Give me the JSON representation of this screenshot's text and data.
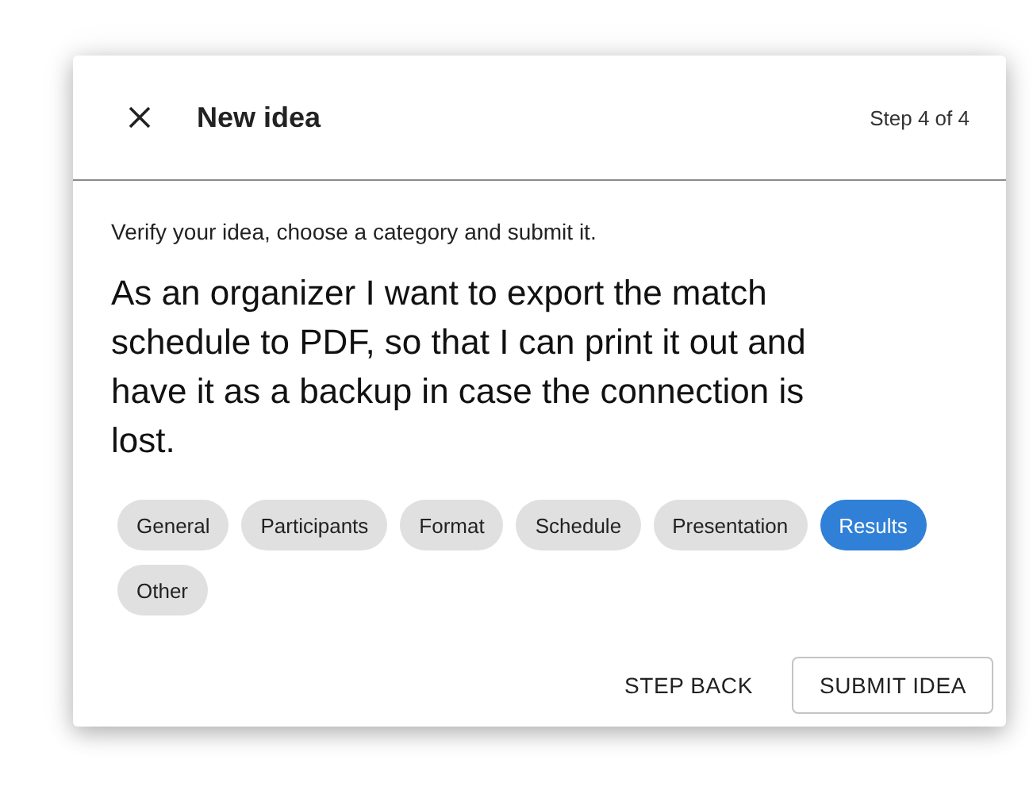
{
  "dialog": {
    "title": "New idea",
    "step": "Step 4 of 4",
    "instruction": "Verify your idea, choose a category and submit it.",
    "idea": "As an organizer I want to export the match schedule to PDF, so that I can print it out and have it as a backup in case the connection is lost.",
    "categories": [
      {
        "label": "General",
        "selected": false
      },
      {
        "label": "Participants",
        "selected": false
      },
      {
        "label": "Format",
        "selected": false
      },
      {
        "label": "Schedule",
        "selected": false
      },
      {
        "label": "Presentation",
        "selected": false
      },
      {
        "label": "Results",
        "selected": true
      },
      {
        "label": "Other",
        "selected": false
      }
    ],
    "buttons": [
      {
        "label": "STEP BACK",
        "kind": "text"
      },
      {
        "label": "SUBMIT IDEA",
        "kind": "outlined"
      }
    ]
  }
}
